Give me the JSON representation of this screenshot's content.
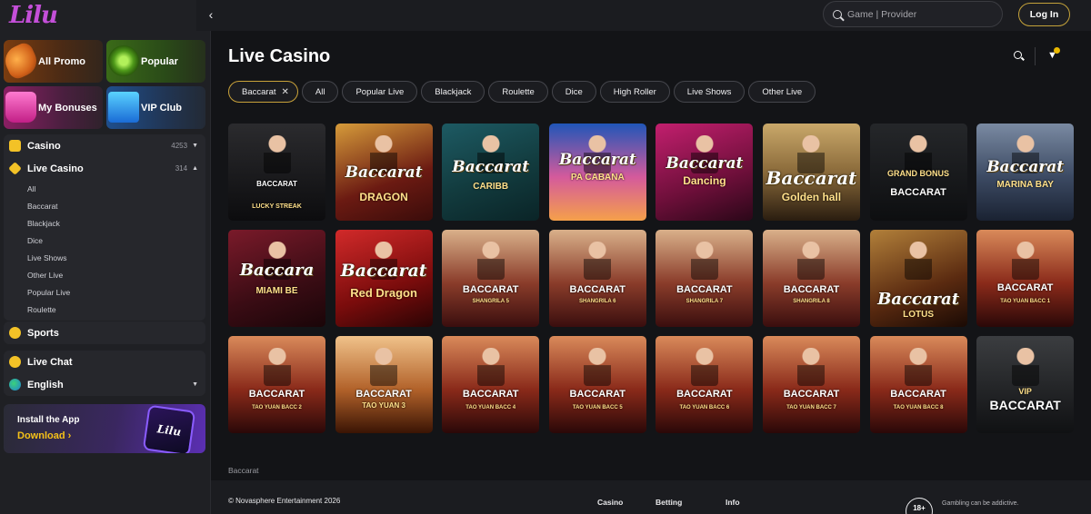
{
  "brand": {
    "logo": "Lilu"
  },
  "sidebar": {
    "promos": [
      {
        "label": "All Promo",
        "icon": "promo-icon"
      },
      {
        "label": "Popular",
        "icon": "popular-icon"
      },
      {
        "label": "My Bonuses",
        "icon": "bonuses-icon"
      },
      {
        "label": "VIP Club",
        "icon": "vip-icon"
      }
    ],
    "casino": {
      "label": "Casino",
      "count": "4253"
    },
    "live_casino": {
      "label": "Live Casino",
      "count": "314"
    },
    "live_sub": [
      "All",
      "Baccarat",
      "Blackjack",
      "Dice",
      "Live Shows",
      "Other Live",
      "Popular Live",
      "Roulette"
    ],
    "sports": {
      "label": "Sports"
    },
    "live_chat": {
      "label": "Live Chat"
    },
    "language": {
      "label": "English"
    },
    "app_banner": {
      "title": "Install the App",
      "cta": "Download ›",
      "phone_text": "Lilu"
    }
  },
  "topbar": {
    "search_placeholder": "Game | Provider",
    "login": "Log In"
  },
  "main": {
    "title": "Live Casino",
    "chips": [
      "Baccarat",
      "All",
      "Popular Live",
      "Blackjack",
      "Roulette",
      "Dice",
      "High Roller",
      "Live Shows",
      "Other Live"
    ],
    "active_chip_close": "✕",
    "breadcrumb": "Baccarat"
  },
  "games": [
    {
      "title": "BACCARAT",
      "sub": "LUCKY STREAK",
      "style": "lucky"
    },
    {
      "title": "Baccarat",
      "sub": "DRAGON",
      "style": "dragon"
    },
    {
      "title": "Baccarat",
      "sub": "CARIBB",
      "style": "caribb"
    },
    {
      "title": "Baccarat",
      "sub": "PA CABANA",
      "style": "cabana"
    },
    {
      "title": "Baccarat",
      "sub": "Dancing",
      "style": "dancing"
    },
    {
      "title": "Baccarat",
      "sub": "Golden hall",
      "style": "golden"
    },
    {
      "title": "BACCARAT",
      "sub": "GRAND BONUS",
      "style": "grand"
    },
    {
      "title": "Baccarat",
      "sub": "MARINA BAY",
      "style": "marina"
    },
    {
      "title": "Baccara",
      "sub": "MIAMI BE",
      "style": "miami"
    },
    {
      "title": "Baccarat",
      "sub": "Red Dragon",
      "style": "reddragon"
    },
    {
      "title": "BACCARAT",
      "sub": "SHANGRILA 5",
      "style": "shangrila"
    },
    {
      "title": "BACCARAT",
      "sub": "SHANGRILA 6",
      "style": "shangrila"
    },
    {
      "title": "BACCARAT",
      "sub": "SHANGRILA 7",
      "style": "shangrila"
    },
    {
      "title": "BACCARAT",
      "sub": "SHANGRILA 8",
      "style": "shangrila"
    },
    {
      "title": "Baccarat",
      "sub": "LOTUS",
      "style": "lotus"
    },
    {
      "title": "BACCARAT",
      "sub": "TAO YUAN  BACC 1",
      "style": "tao"
    },
    {
      "title": "BACCARAT",
      "sub": "TAO YUAN  BACC 2",
      "style": "tao"
    },
    {
      "title": "BACCARAT",
      "sub": "TAO YUAN 3",
      "style": "tao3"
    },
    {
      "title": "BACCARAT",
      "sub": "TAO YUAN  BACC 4",
      "style": "tao"
    },
    {
      "title": "BACCARAT",
      "sub": "TAO YUAN  BACC 5",
      "style": "tao"
    },
    {
      "title": "BACCARAT",
      "sub": "TAO YUAN  BACC 6",
      "style": "tao"
    },
    {
      "title": "BACCARAT",
      "sub": "TAO YUAN  BACC 7",
      "style": "tao"
    },
    {
      "title": "BACCARAT",
      "sub": "TAO YUAN  BACC 8",
      "style": "tao"
    },
    {
      "title": "BACCARAT",
      "sub": "VIP",
      "style": "vip"
    }
  ],
  "footer": {
    "copyright": "© Novasphere Entertainment 2026",
    "links": [
      "Casino",
      "Betting",
      "Info"
    ],
    "age": "18+",
    "responsible": "Gambling can be addictive."
  }
}
